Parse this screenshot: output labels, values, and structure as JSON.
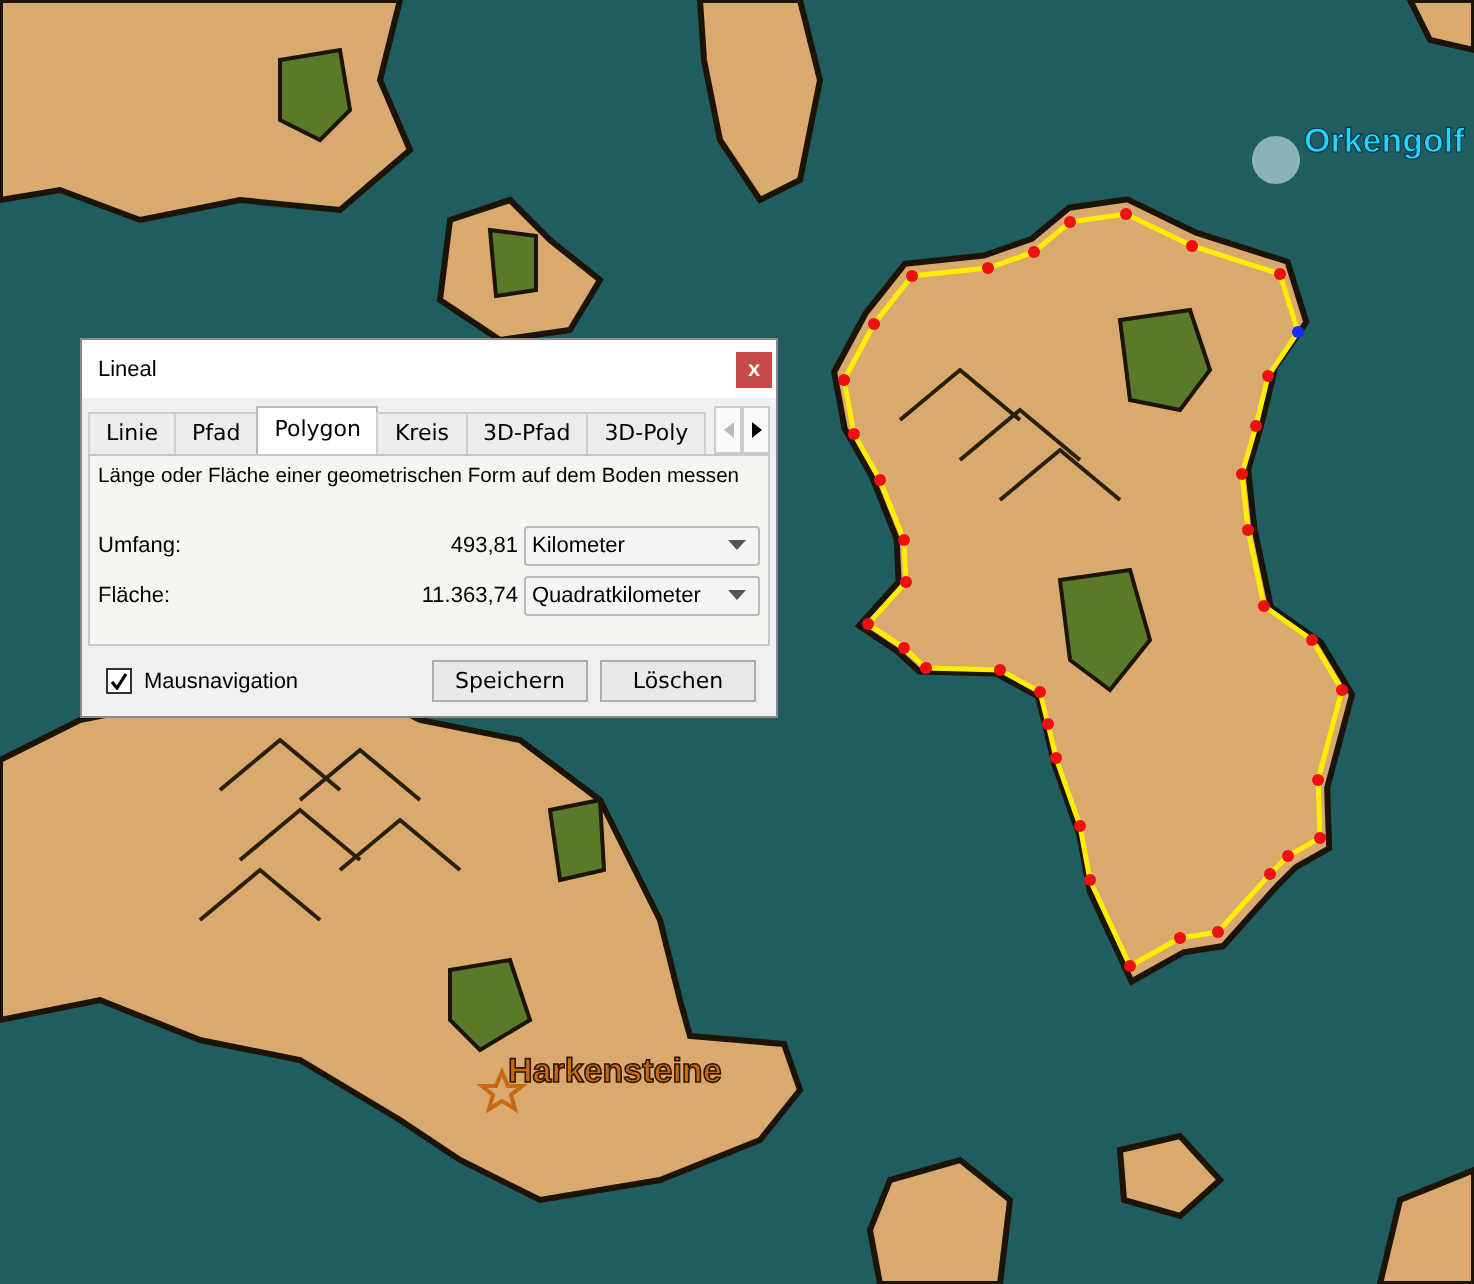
{
  "map": {
    "labels": [
      {
        "kind": "water",
        "text": "Orkengolf"
      },
      {
        "kind": "place",
        "text": "Harkensteine"
      }
    ]
  },
  "dialog": {
    "title": "Lineal",
    "close": "x",
    "tabs": [
      {
        "label": "Linie",
        "selected": false
      },
      {
        "label": "Pfad",
        "selected": false
      },
      {
        "label": "Polygon",
        "selected": true
      },
      {
        "label": "Kreis",
        "selected": false
      },
      {
        "label": "3D-Pfad",
        "selected": false
      },
      {
        "label": "3D-Poly",
        "selected": false
      }
    ],
    "description": "Länge oder Fläche einer geometrischen Form auf dem Boden messen",
    "measurements": [
      {
        "label": "Umfang:",
        "value": "493,81",
        "unit": "Kilometer"
      },
      {
        "label": "Fläche:",
        "value": "11.363,74",
        "unit": "Quadratkilometer"
      }
    ],
    "mouse_navigation": {
      "label": "Mausnavigation",
      "checked": true
    },
    "buttons": [
      "Speichern",
      "Löschen"
    ]
  }
}
